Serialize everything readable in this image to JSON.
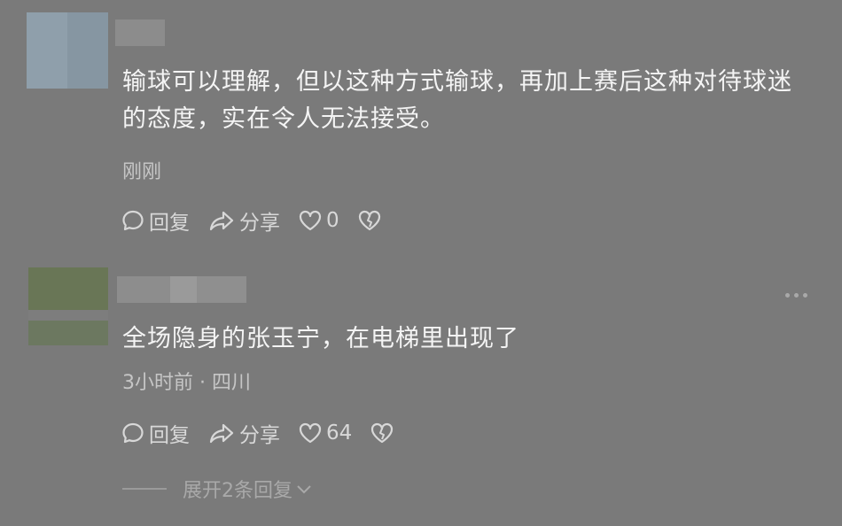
{
  "comments": [
    {
      "text": "输球可以理解，但以这种方式输球，再加上赛后这种对待球迷的态度，实在令人无法接受。",
      "meta": "刚刚",
      "reply_label": "回复",
      "share_label": "分享",
      "likes": "0"
    },
    {
      "text": "全场隐身的张玉宁，在电梯里出现了",
      "meta": "3小时前 · 四川",
      "reply_label": "回复",
      "share_label": "分享",
      "likes": "64"
    }
  ],
  "expand_replies": "展开2条回复",
  "icons": {
    "reply": "comment-bubble-icon",
    "share": "share-arrow-icon",
    "like": "heart-icon",
    "dislike": "broken-heart-icon",
    "more": "more-dots-icon",
    "expand": "chevron-down-icon"
  },
  "colors": {
    "background": "#7a7a7a",
    "text": "#f4f4f4",
    "meta": "#c6c6c6",
    "action": "#d8d8d8"
  }
}
